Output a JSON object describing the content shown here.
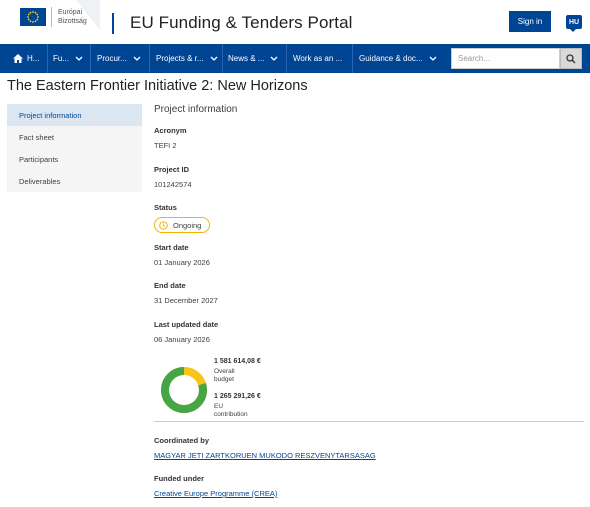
{
  "header": {
    "logo_line1": "Európai",
    "logo_line2": "Bizottság",
    "portal_title": "EU Funding & Tenders Portal",
    "signin_label": "Sign in",
    "language_code": "HU"
  },
  "nav": {
    "items": [
      {
        "label": "H..."
      },
      {
        "label": "Fu..."
      },
      {
        "label": "Procur..."
      },
      {
        "label": "Projects & r..."
      },
      {
        "label": "News & ..."
      },
      {
        "label": "Work as an ..."
      },
      {
        "label": "Guidance & doc..."
      }
    ],
    "search_placeholder": "Search..."
  },
  "page": {
    "title": "The Eastern Frontier Initiative 2: New Horizons"
  },
  "sidebar": {
    "items": [
      {
        "label": "Project information"
      },
      {
        "label": "Fact sheet"
      },
      {
        "label": "Participants"
      },
      {
        "label": "Deliverables"
      }
    ]
  },
  "project": {
    "section_title": "Project information",
    "acronym_label": "Acronym",
    "acronym_value": "TEFI 2",
    "id_label": "Project ID",
    "id_value": "101242574",
    "status_label": "Status",
    "status_value": "Ongoing",
    "start_label": "Start date",
    "start_value": "01 January 2026",
    "end_label": "End date",
    "end_value": "31 December 2027",
    "updated_label": "Last updated date",
    "updated_value": "06 January 2026"
  },
  "budget": {
    "overall_amount": "1 581 614,08 €",
    "overall_label_1": "Overall",
    "overall_label_2": "budget",
    "eu_amount": "1 265 291,26 €",
    "eu_label_1": "EU",
    "eu_label_2": "contribution",
    "eu_share": 0.8,
    "colors": {
      "eu": "#46a546",
      "other": "#f5c518"
    }
  },
  "coordination": {
    "coordinated_label": "Coordinated by",
    "coordinator": "MAGYAR JETI ZARTKORUEN MUKODO RESZVENYTARSASAG",
    "funded_label": "Funded under",
    "programme": "Creative Europe Programme (CREA)"
  },
  "colors": {
    "brand_blue": "#004494",
    "status_border": "#f0b400"
  }
}
